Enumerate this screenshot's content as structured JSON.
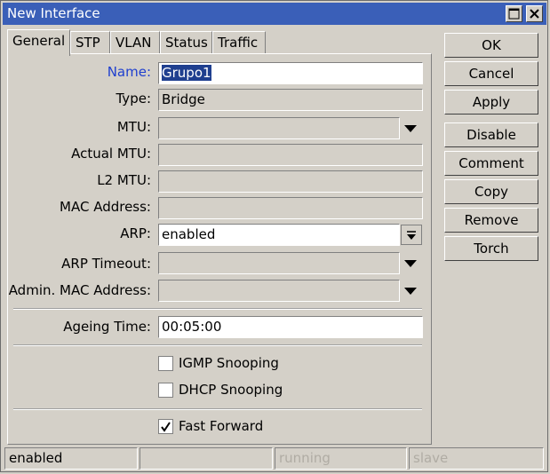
{
  "window": {
    "title": "New Interface",
    "restore_icon": "maximize-icon",
    "close_icon": "close-icon"
  },
  "tabs": [
    {
      "label": "General",
      "active": true
    },
    {
      "label": "STP"
    },
    {
      "label": "VLAN"
    },
    {
      "label": "Status"
    },
    {
      "label": "Traffic"
    }
  ],
  "form": {
    "name": {
      "label": "Name:",
      "value": "Grupo1"
    },
    "type": {
      "label": "Type:",
      "value": "Bridge"
    },
    "mtu": {
      "label": "MTU:",
      "value": ""
    },
    "actual_mtu": {
      "label": "Actual MTU:",
      "value": ""
    },
    "l2_mtu": {
      "label": "L2 MTU:",
      "value": ""
    },
    "mac_address": {
      "label": "MAC Address:",
      "value": ""
    },
    "arp": {
      "label": "ARP:",
      "value": "enabled"
    },
    "arp_timeout": {
      "label": "ARP Timeout:",
      "value": ""
    },
    "admin_mac": {
      "label": "Admin. MAC Address:",
      "value": ""
    },
    "ageing_time": {
      "label": "Ageing Time:",
      "value": "00:05:00"
    },
    "igmp_snooping": {
      "label": "IGMP Snooping",
      "checked": false
    },
    "dhcp_snooping": {
      "label": "DHCP Snooping",
      "checked": false
    },
    "fast_forward": {
      "label": "Fast Forward",
      "checked": true
    }
  },
  "buttons": {
    "ok": "OK",
    "cancel": "Cancel",
    "apply": "Apply",
    "disable": "Disable",
    "comment": "Comment",
    "copy": "Copy",
    "remove": "Remove",
    "torch": "Torch"
  },
  "statusbar": {
    "state": "enabled",
    "empty": "",
    "running": "running",
    "slave": "slave"
  },
  "colors": {
    "titlebar": "#3a5fb8",
    "name_label": "#1f3fcf",
    "selection": "#1f3f8f"
  }
}
